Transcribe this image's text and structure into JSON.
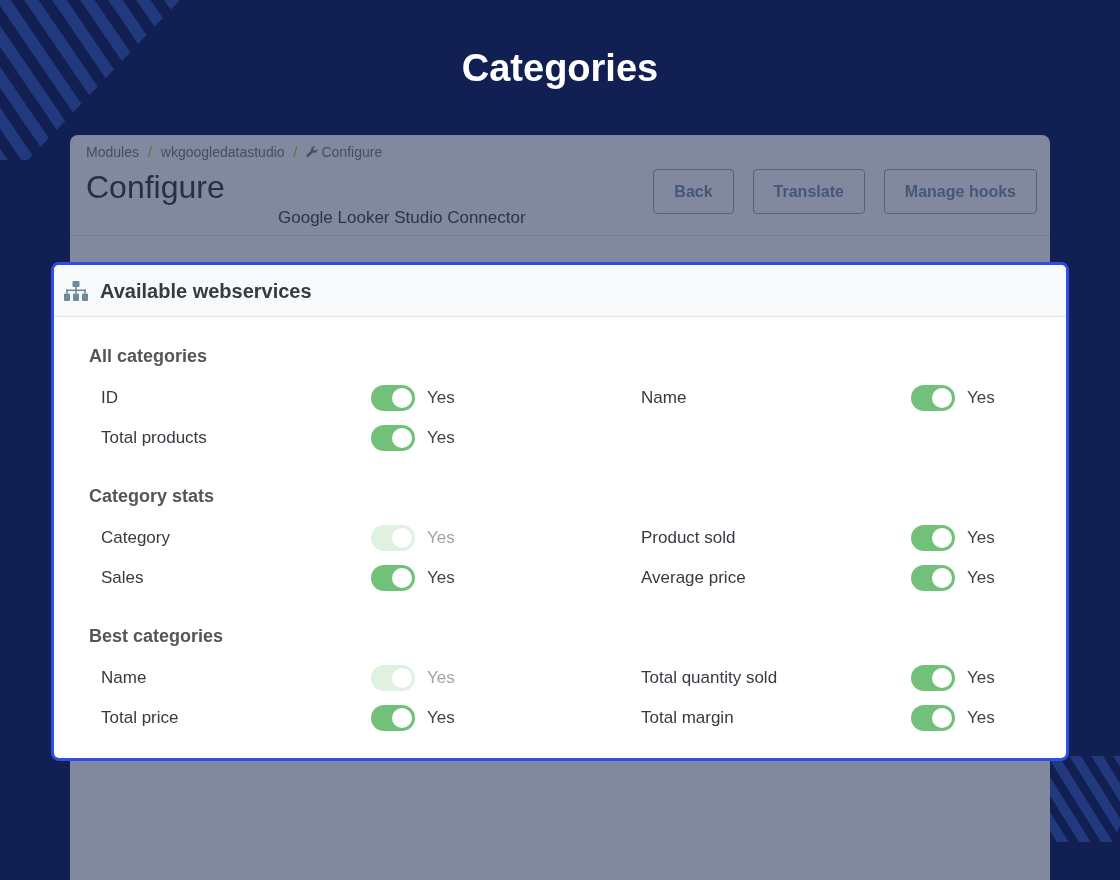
{
  "page_title": "Categories",
  "breadcrumb": [
    {
      "kind": "link",
      "label": "Modules"
    },
    {
      "kind": "separator",
      "label": "/"
    },
    {
      "kind": "link",
      "label": "wkgoogledatastudio"
    },
    {
      "kind": "separator",
      "label": "/"
    },
    {
      "kind": "current",
      "label": "Configure"
    }
  ],
  "header": {
    "title": "Configure",
    "subtitle": "Google Looker Studio Connector",
    "buttons": [
      "Back",
      "Translate",
      "Manage hooks"
    ]
  },
  "modal": {
    "title": "Available webservices",
    "sections": [
      {
        "title": "All categories",
        "fields": [
          {
            "label": "ID",
            "on": true,
            "disabled": false,
            "value": "Yes"
          },
          {
            "label": "Name",
            "on": true,
            "disabled": false,
            "value": "Yes"
          },
          {
            "label": "Total products",
            "on": true,
            "disabled": false,
            "value": "Yes"
          }
        ]
      },
      {
        "title": "Category stats",
        "fields": [
          {
            "label": "Category",
            "on": true,
            "disabled": true,
            "value": "Yes"
          },
          {
            "label": "Product sold",
            "on": true,
            "disabled": false,
            "value": "Yes"
          },
          {
            "label": "Sales",
            "on": true,
            "disabled": false,
            "value": "Yes"
          },
          {
            "label": "Average price",
            "on": true,
            "disabled": false,
            "value": "Yes"
          }
        ]
      },
      {
        "title": "Best categories",
        "fields": [
          {
            "label": "Name",
            "on": true,
            "disabled": true,
            "value": "Yes"
          },
          {
            "label": "Total quantity sold",
            "on": true,
            "disabled": false,
            "value": "Yes"
          },
          {
            "label": "Total price",
            "on": true,
            "disabled": false,
            "value": "Yes"
          },
          {
            "label": "Total margin",
            "on": true,
            "disabled": false,
            "value": "Yes"
          }
        ]
      }
    ]
  }
}
